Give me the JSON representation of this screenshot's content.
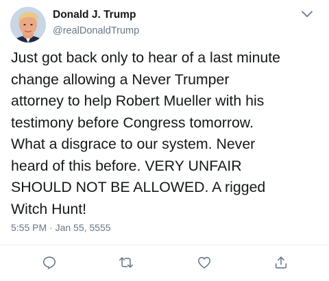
{
  "colors": {
    "text_primary": "#14171a",
    "text_secondary": "#657786",
    "icon": "#657786",
    "divider": "#e6ecf0"
  },
  "author": {
    "display_name": "Donald J. Trump",
    "handle": "@realDonaldTrump",
    "avatar_icon": "profile-photo"
  },
  "tweet": {
    "text_lines": [
      "Just got back only to hear of a last minute",
      "change allowing a Never Trumper",
      "attorney to help Robert Mueller with his",
      "testimony before Congress tomorrow.",
      "What a disgrace to our system. Never",
      "heard of this before. VERY UNFAIR",
      "SHOULD NOT BE ALLOWED. A rigged",
      "Witch Hunt!"
    ],
    "timestamp": "5:55 PM · Jan 55, 5555"
  },
  "menu": {
    "icon": "chevron-down-icon"
  },
  "actions": [
    {
      "icon": "reply-icon"
    },
    {
      "icon": "retweet-icon"
    },
    {
      "icon": "like-icon"
    },
    {
      "icon": "share-icon"
    }
  ]
}
